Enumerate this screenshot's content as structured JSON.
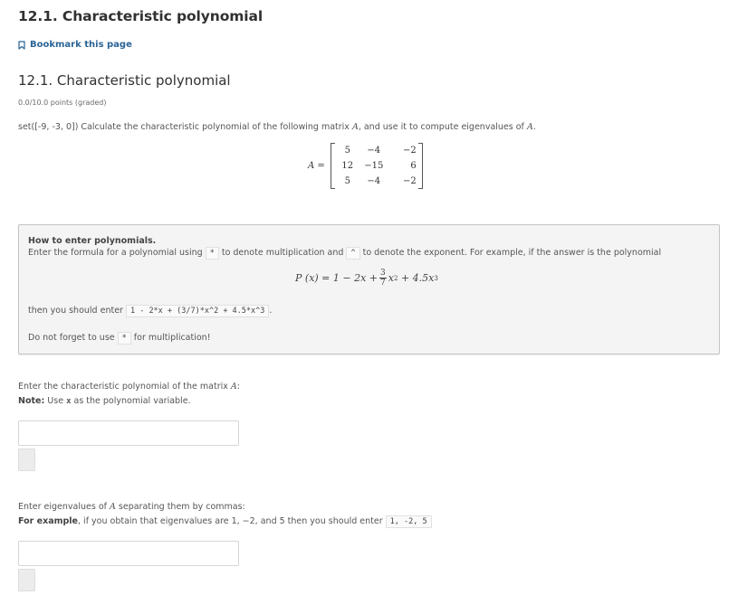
{
  "header": {
    "page_title": "12.1. Characteristic polynomial",
    "bookmark_label": "Bookmark this page",
    "bookmark_icon": "bookmark-icon",
    "accent_color": "#2a6496"
  },
  "problem": {
    "title": "12.1. Characteristic polynomial",
    "points": "0.0/10.0 points (graded)",
    "prompt_prefix": "set([-9, -3, 0]) Calculate the characteristic polynomial of the following matrix ",
    "prompt_var": "A",
    "prompt_middle": ", and use it to compute eigenvalues of ",
    "prompt_var2": "A",
    "prompt_suffix": ".",
    "matrix": {
      "lhs": "A =",
      "rows": [
        [
          "5",
          "−4",
          "−2"
        ],
        [
          "12",
          "−15",
          "6"
        ],
        [
          "5",
          "−4",
          "−2"
        ]
      ]
    }
  },
  "hint": {
    "title": "How to enter polynomials.",
    "line1_a": "Enter the formula for a polynomial using ",
    "code_mult": "*",
    "line1_b": " to denote multiplication and ",
    "code_exp": "^",
    "line1_c": " to denote the exponent. For example, if the answer is the polynomial",
    "formula": {
      "lhs": "P (x) = 1 − 2x + ",
      "frac_num": "3",
      "frac_den": "7",
      "term2": "x",
      "term2_exp": "2",
      "plus": " + 4.5x",
      "term3_exp": "3"
    },
    "line2_a": "then you should enter ",
    "code_example": "1 - 2*x + (3/7)*x^2 + 4.5*x^3",
    "line2_b": ".",
    "line3_a": "Do not forget to use ",
    "code_mult2": "*",
    "line3_b": " for multiplication!"
  },
  "question1": {
    "label_prefix": "Enter the characteristic polynomial of the matrix ",
    "label_var": "A",
    "label_suffix": ":",
    "note_bold": "Note:",
    "note_a": " Use ",
    "note_var": "x",
    "note_b": " as the polynomial variable.",
    "input_value": "",
    "input_placeholder": ""
  },
  "question2": {
    "label_prefix": "Enter eigenvalues of ",
    "label_var": "A",
    "label_suffix": " separating them by commas:",
    "note_bold": "For example",
    "note_a": ", if you obtain that eigenvalues are 1, −2, and 5 then you should enter ",
    "note_code": "1, -2, 5",
    "input_value": "",
    "input_placeholder": ""
  }
}
